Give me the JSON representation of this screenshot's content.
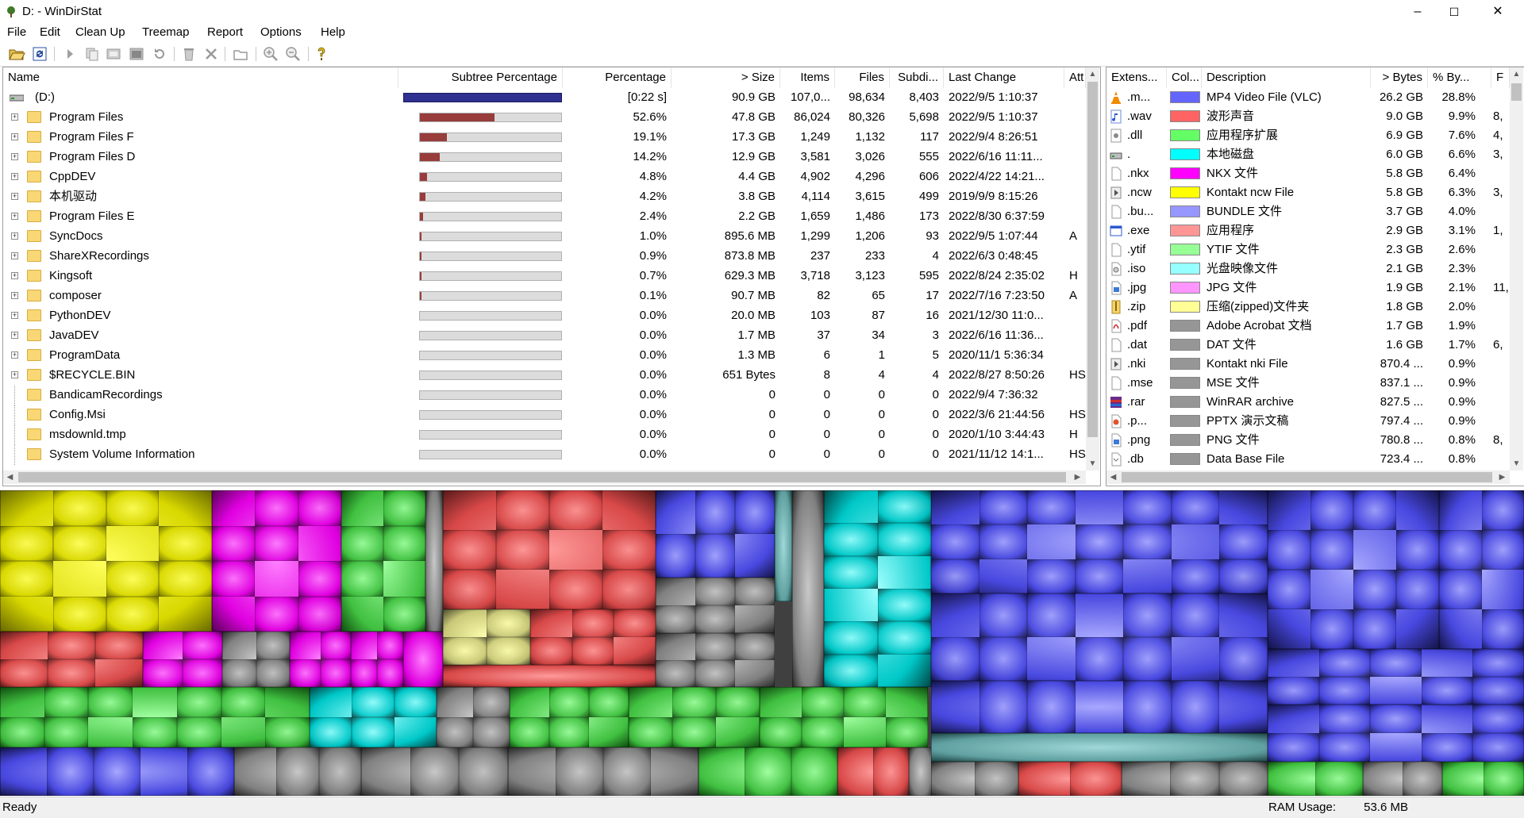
{
  "window": {
    "title": "D: - WinDirStat",
    "minimize": "–",
    "maximize": "☐",
    "close": "✕"
  },
  "menu": [
    "File",
    "Edit",
    "Clean Up",
    "Treemap",
    "Report",
    "Options",
    "Help"
  ],
  "dir_columns": [
    "Name",
    "Subtree Percentage",
    "Percentage",
    "> Size",
    "Items",
    "Files",
    "Subdi...",
    "Last Change",
    "Att"
  ],
  "dir_rows": [
    {
      "name": "(D:)",
      "bar": 1.0,
      "root": true,
      "percentage": "[0:22 s]",
      "size": "90.9 GB",
      "items": "107,0...",
      "files": "98,634",
      "subdirs": "8,403",
      "last_change": "2022/9/5  1:10:37",
      "attr": ""
    },
    {
      "name": "Program Files",
      "bar": 0.526,
      "percentage": "52.6%",
      "size": "47.8 GB",
      "items": "86,024",
      "files": "80,326",
      "subdirs": "5,698",
      "last_change": "2022/9/5  1:10:37",
      "attr": ""
    },
    {
      "name": "Program Files F",
      "bar": 0.191,
      "percentage": "19.1%",
      "size": "17.3 GB",
      "items": "1,249",
      "files": "1,132",
      "subdirs": "117",
      "last_change": "2022/9/4  8:26:51",
      "attr": ""
    },
    {
      "name": "Program Files D",
      "bar": 0.142,
      "percentage": "14.2%",
      "size": "12.9 GB",
      "items": "3,581",
      "files": "3,026",
      "subdirs": "555",
      "last_change": "2022/6/16  11:11...",
      "attr": ""
    },
    {
      "name": "CppDEV",
      "bar": 0.048,
      "percentage": "4.8%",
      "size": "4.4 GB",
      "items": "4,902",
      "files": "4,296",
      "subdirs": "606",
      "last_change": "2022/4/22  14:21...",
      "attr": ""
    },
    {
      "name": "本机驱动",
      "bar": 0.042,
      "percentage": "4.2%",
      "size": "3.8 GB",
      "items": "4,114",
      "files": "3,615",
      "subdirs": "499",
      "last_change": "2019/9/9  8:15:26",
      "attr": ""
    },
    {
      "name": "Program Files E",
      "bar": 0.024,
      "percentage": "2.4%",
      "size": "2.2 GB",
      "items": "1,659",
      "files": "1,486",
      "subdirs": "173",
      "last_change": "2022/8/30  6:37:59",
      "attr": ""
    },
    {
      "name": "SyncDocs",
      "bar": 0.01,
      "percentage": "1.0%",
      "size": "895.6 MB",
      "items": "1,299",
      "files": "1,206",
      "subdirs": "93",
      "last_change": "2022/9/5  1:07:44",
      "attr": "A"
    },
    {
      "name": "ShareXRecordings",
      "bar": 0.009,
      "percentage": "0.9%",
      "size": "873.8 MB",
      "items": "237",
      "files": "233",
      "subdirs": "4",
      "last_change": "2022/6/3  0:48:45",
      "attr": ""
    },
    {
      "name": "Kingsoft",
      "bar": 0.007,
      "percentage": "0.7%",
      "size": "629.3 MB",
      "items": "3,718",
      "files": "3,123",
      "subdirs": "595",
      "last_change": "2022/8/24  2:35:02",
      "attr": "H"
    },
    {
      "name": "composer",
      "bar": 0.001,
      "percentage": "0.1%",
      "size": "90.7 MB",
      "items": "82",
      "files": "65",
      "subdirs": "17",
      "last_change": "2022/7/16  7:23:50",
      "attr": "A"
    },
    {
      "name": "PythonDEV",
      "bar": 0.0,
      "percentage": "0.0%",
      "size": "20.0 MB",
      "items": "103",
      "files": "87",
      "subdirs": "16",
      "last_change": "2021/12/30  11:0...",
      "attr": ""
    },
    {
      "name": "JavaDEV",
      "bar": 0.0,
      "percentage": "0.0%",
      "size": "1.7 MB",
      "items": "37",
      "files": "34",
      "subdirs": "3",
      "last_change": "2022/6/16  11:36...",
      "attr": ""
    },
    {
      "name": "ProgramData",
      "bar": 0.0,
      "percentage": "0.0%",
      "size": "1.3 MB",
      "items": "6",
      "files": "1",
      "subdirs": "5",
      "last_change": "2020/11/1  5:36:34",
      "attr": ""
    },
    {
      "name": "$RECYCLE.BIN",
      "bar": 0.0,
      "percentage": "0.0%",
      "size": "651 Bytes",
      "items": "8",
      "files": "4",
      "subdirs": "4",
      "last_change": "2022/8/27  8:50:26",
      "attr": "HS"
    },
    {
      "name": "BandicamRecordings",
      "bar": 0.0,
      "leaf": true,
      "percentage": "0.0%",
      "size": "0",
      "items": "0",
      "files": "0",
      "subdirs": "0",
      "last_change": "2022/9/4  7:36:32",
      "attr": ""
    },
    {
      "name": "Config.Msi",
      "bar": 0.0,
      "leaf": true,
      "percentage": "0.0%",
      "size": "0",
      "items": "0",
      "files": "0",
      "subdirs": "0",
      "last_change": "2022/3/6  21:44:56",
      "attr": "HS"
    },
    {
      "name": "msdownld.tmp",
      "bar": 0.0,
      "leaf": true,
      "percentage": "0.0%",
      "size": "0",
      "items": "0",
      "files": "0",
      "subdirs": "0",
      "last_change": "2020/1/10  3:44:43",
      "attr": "H"
    },
    {
      "name": "System Volume Information",
      "bar": 0.0,
      "leaf": true,
      "percentage": "0.0%",
      "size": "0",
      "items": "0",
      "files": "0",
      "subdirs": "0",
      "last_change": "2021/11/12  14:1...",
      "attr": "HS"
    }
  ],
  "ext_columns": [
    "Extens...",
    "Col...",
    "Description",
    "> Bytes",
    "% By...",
    "F"
  ],
  "ext_rows": [
    {
      "ext": ".m...",
      "color": "#6464ff",
      "icon": "vlc-cone-icon",
      "desc": "MP4 Video File (VLC)",
      "bytes": "26.2 GB",
      "pct": "28.8%",
      "files": ""
    },
    {
      "ext": ".wav",
      "color": "#ff6464",
      "icon": "audio-file-icon",
      "desc": "波形声音",
      "bytes": "9.0 GB",
      "pct": "9.9%",
      "files": "8,"
    },
    {
      "ext": ".dll",
      "color": "#64ff64",
      "icon": "dll-file-icon",
      "desc": "应用程序扩展",
      "bytes": "6.9 GB",
      "pct": "7.6%",
      "files": "4,"
    },
    {
      "ext": ".",
      "color": "#00ffff",
      "icon": "drive-icon",
      "desc": "本地磁盘",
      "bytes": "6.0 GB",
      "pct": "6.6%",
      "files": "3,"
    },
    {
      "ext": ".nkx",
      "color": "#ff00ff",
      "icon": "blank-file-icon",
      "desc": "NKX 文件",
      "bytes": "5.8 GB",
      "pct": "6.4%",
      "files": ""
    },
    {
      "ext": ".ncw",
      "color": "#ffff00",
      "icon": "media-file-icon",
      "desc": "Kontakt ncw File",
      "bytes": "5.8 GB",
      "pct": "6.3%",
      "files": "3,"
    },
    {
      "ext": ".bu...",
      "color": "#9696ff",
      "icon": "blank-file-icon",
      "desc": "BUNDLE 文件",
      "bytes": "3.7 GB",
      "pct": "4.0%",
      "files": ""
    },
    {
      "ext": ".exe",
      "color": "#ff9696",
      "icon": "exe-file-icon",
      "desc": "应用程序",
      "bytes": "2.9 GB",
      "pct": "3.1%",
      "files": "1,"
    },
    {
      "ext": ".ytif",
      "color": "#96ff96",
      "icon": "blank-file-icon",
      "desc": "YTIF 文件",
      "bytes": "2.3 GB",
      "pct": "2.6%",
      "files": ""
    },
    {
      "ext": ".iso",
      "color": "#96ffff",
      "icon": "disc-file-icon",
      "desc": "光盘映像文件",
      "bytes": "2.1 GB",
      "pct": "2.3%",
      "files": ""
    },
    {
      "ext": ".jpg",
      "color": "#ff96ff",
      "icon": "image-file-icon",
      "desc": "JPG 文件",
      "bytes": "1.9 GB",
      "pct": "2.1%",
      "files": "11,"
    },
    {
      "ext": ".zip",
      "color": "#ffff96",
      "icon": "zip-file-icon",
      "desc": "压缩(zipped)文件夹",
      "bytes": "1.8 GB",
      "pct": "2.0%",
      "files": ""
    },
    {
      "ext": ".pdf",
      "color": "#969696",
      "icon": "pdf-file-icon",
      "desc": "Adobe Acrobat 文档",
      "bytes": "1.7 GB",
      "pct": "1.9%",
      "files": ""
    },
    {
      "ext": ".dat",
      "color": "#969696",
      "icon": "blank-file-icon",
      "desc": "DAT 文件",
      "bytes": "1.6 GB",
      "pct": "1.7%",
      "files": "6,"
    },
    {
      "ext": ".nki",
      "color": "#969696",
      "icon": "media-file-icon",
      "desc": "Kontakt nki File",
      "bytes": "870.4 ...",
      "pct": "0.9%",
      "files": ""
    },
    {
      "ext": ".mse",
      "color": "#969696",
      "icon": "blank-file-icon",
      "desc": "MSE 文件",
      "bytes": "837.1 ...",
      "pct": "0.9%",
      "files": ""
    },
    {
      "ext": ".rar",
      "color": "#969696",
      "icon": "winrar-icon",
      "desc": "WinRAR archive",
      "bytes": "827.5 ...",
      "pct": "0.9%",
      "files": ""
    },
    {
      "ext": ".p...",
      "color": "#969696",
      "icon": "pptx-file-icon",
      "desc": "PPTX 演示文稿",
      "bytes": "797.4 ...",
      "pct": "0.9%",
      "files": ""
    },
    {
      "ext": ".png",
      "color": "#969696",
      "icon": "image-file-icon",
      "desc": "PNG 文件",
      "bytes": "780.8 ...",
      "pct": "0.8%",
      "files": "8,"
    },
    {
      "ext": ".db",
      "color": "#969696",
      "icon": "db-file-icon",
      "desc": "Data Base File",
      "bytes": "723.4 ...",
      "pct": "0.8%",
      "files": ""
    }
  ],
  "status": {
    "left": "Ready",
    "ram_label": "RAM Usage:",
    "ram_value": "53.6 MB"
  },
  "colors": {
    "bar_fill": "#983c3c",
    "root_bar": "#2e318f",
    "folder": "#f8d774"
  }
}
